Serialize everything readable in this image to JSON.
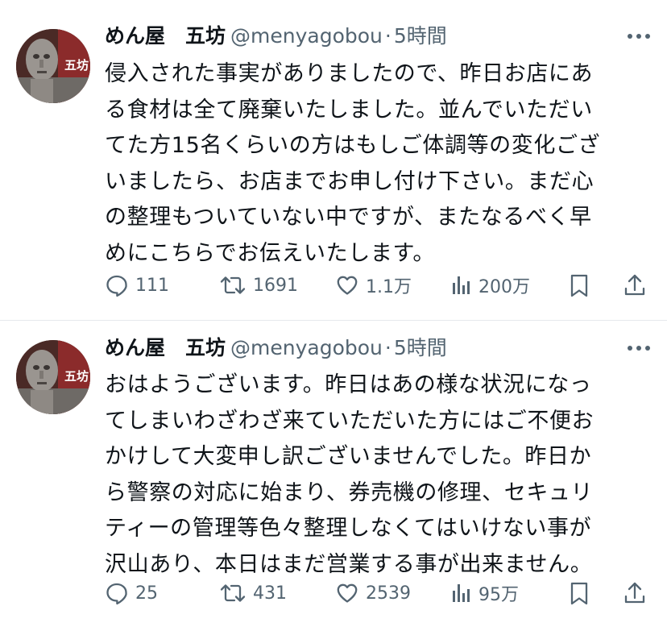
{
  "tweets": [
    {
      "author_name": "めん屋　五坊",
      "handle": "@menyagobou",
      "separator": "·",
      "time": "5時間",
      "avatar_sign_text": "五坊",
      "text": "侵入された事実がありましたので、昨日お店にあ\nる食材は全て廃棄いたしました。並んでいただい\nてた方15名くらいの方はもしご体調等の変化ござ\nいましたら、お店までお申し付け下さい。まだ心\nの整理もついていない中ですが、またなるべく早\nめにこちらでお伝えいたします。",
      "replies": "111",
      "retweets": "1691",
      "likes": "1.1万",
      "views": "200万"
    },
    {
      "author_name": "めん屋　五坊",
      "handle": "@menyagobou",
      "separator": "·",
      "time": "5時間",
      "avatar_sign_text": "五坊",
      "text": "おはようございます。昨日はあの様な状況になっ\nてしまいわざわざ来ていただいた方にはご不便お\nかけして大変申し訳ございませんでした。昨日か\nら警察の対応に始まり、券売機の修理、セキュリ\nティーの管理等色々整理しなくてはいけない事が\n沢山あり、本日はまだ営業する事が出来ません。",
      "replies": "25",
      "retweets": "431",
      "likes": "2539",
      "views": "95万"
    }
  ],
  "icons": {
    "reply": "speech-bubble-icon",
    "retweet": "retweet-arrows-icon",
    "like": "heart-icon",
    "views": "bar-chart-icon",
    "bookmark": "bookmark-icon",
    "share": "share-upload-icon",
    "more": "more-dots-icon"
  },
  "colors": {
    "text": "#0f1419",
    "secondary": "#536471",
    "divider": "#e6e9ec",
    "avatar_banner": "#8b2b2b"
  }
}
